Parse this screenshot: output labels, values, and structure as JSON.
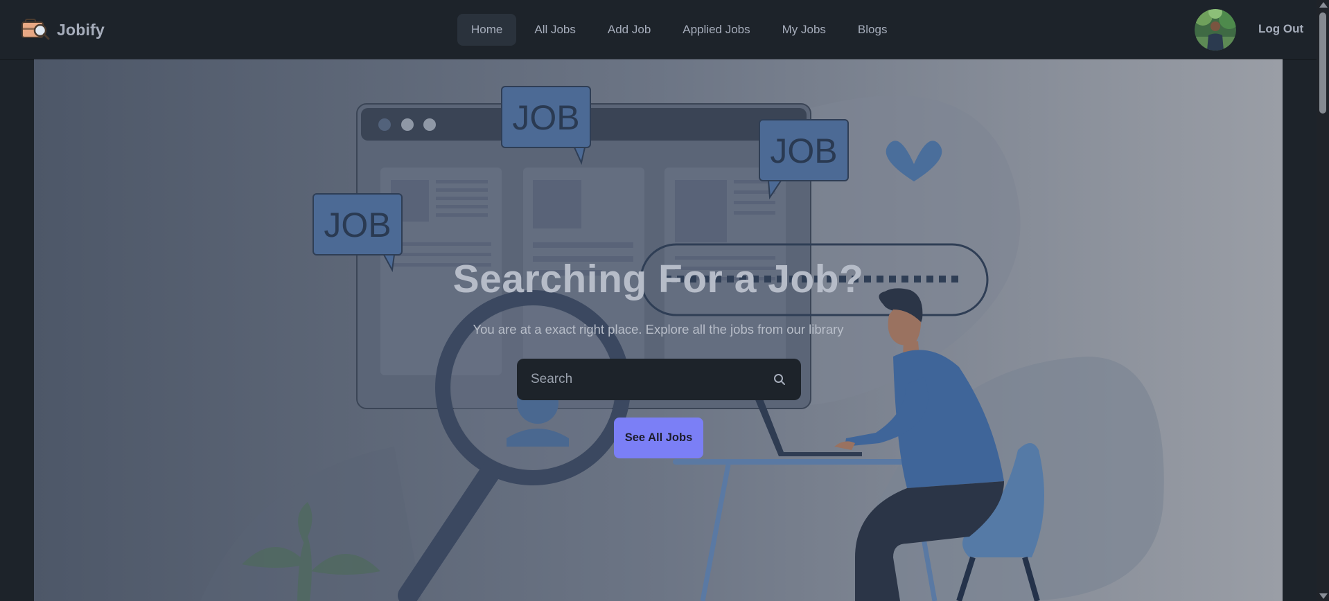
{
  "app": {
    "name": "Jobify"
  },
  "nav": {
    "items": [
      {
        "label": "Home",
        "active": true
      },
      {
        "label": "All Jobs"
      },
      {
        "label": "Add Job"
      },
      {
        "label": "Applied Jobs"
      },
      {
        "label": "My Jobs"
      },
      {
        "label": "Blogs"
      }
    ],
    "logout_label": "Log Out"
  },
  "hero": {
    "title": "Searching For a Job?",
    "subtitle": "You are at a exact right place. Explore all the jobs from our library",
    "search_placeholder": "Search",
    "cta_label": "See All Jobs",
    "bubble_text": "JOB"
  },
  "colors": {
    "page_bg": "#1d232a",
    "nav_active_bg": "#2a323c",
    "accent_button": "#7b7ff6",
    "text": "#a6adbb"
  },
  "icons": [
    "briefcase-logo-icon",
    "search-icon",
    "user-avatar",
    "heart-icon"
  ]
}
